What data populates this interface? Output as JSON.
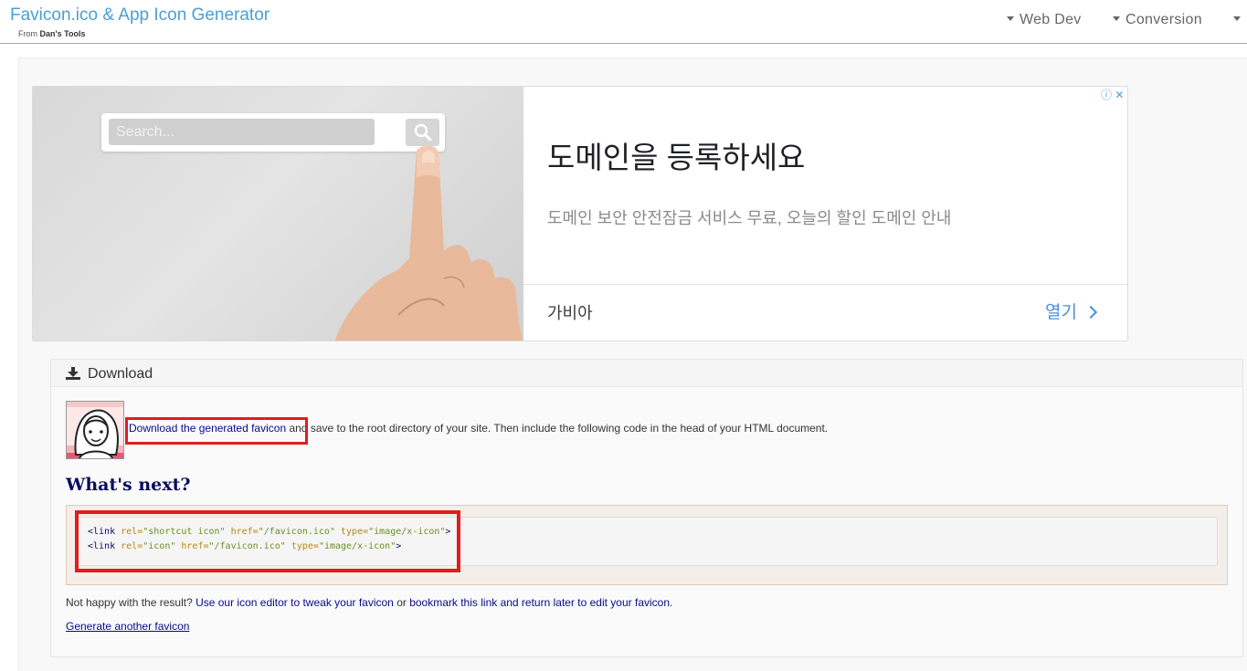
{
  "header": {
    "title": "Favicon.ico & App Icon Generator",
    "subtitle_prefix": "From ",
    "subtitle_brand": "Dan's Tools",
    "nav": [
      {
        "label": "Web Dev"
      },
      {
        "label": "Conversion"
      }
    ]
  },
  "ad": {
    "search_placeholder": "Search...",
    "headline": "도메인을 등록하세요",
    "description": "도메인 보안 안전잠금 서비스 무료, 오늘의 할인 도메인 안내",
    "advertiser": "가비아",
    "open_label": "열기",
    "adchoices": "ⓘ",
    "close": "✕"
  },
  "download": {
    "title": "Download",
    "link_text": "Download the generated favicon",
    "line_rest": " and save to the root directory of your site. Then include the following code in the head of your HTML document.",
    "whats_next": "What's next?",
    "code_lines": [
      {
        "open": "<link",
        "rel_attr": "rel=",
        "rel_val": "\"shortcut icon\"",
        "href_attr": "href=",
        "href_val": "\"/favicon.ico\"",
        "type_attr": "type=",
        "type_val": "\"image/x-icon\"",
        "close": ">"
      },
      {
        "open": "<link",
        "rel_attr": "rel=",
        "rel_val": "\"icon\"",
        "href_attr": "href=",
        "href_val": "\"/favicon.ico\"",
        "type_attr": "type=",
        "type_val": "\"image/x-icon\"",
        "close": ">"
      }
    ],
    "unhappy_prefix": "Not happy with the result? ",
    "editor_link": "Use our icon editor to tweak your favicon",
    "or_text": " or ",
    "bookmark_link": "bookmark this link and return later to edit your favicon",
    "period": ".",
    "generate_another": "Generate another favicon"
  },
  "colors": {
    "brand": "#4a9fd5",
    "highlight": "#e21c1c",
    "link": "#0a0a8a",
    "heading": "#0b0b5e"
  }
}
